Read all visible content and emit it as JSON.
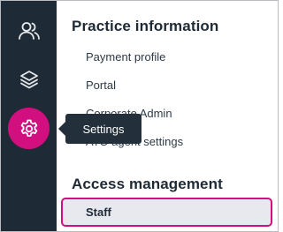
{
  "rail": {
    "items": [
      {
        "name": "people-icon",
        "active": false
      },
      {
        "name": "layers-icon",
        "active": false
      },
      {
        "name": "gear-icon",
        "active": true
      }
    ]
  },
  "tooltip": {
    "label": "Settings"
  },
  "sections": {
    "practice": {
      "title": "Practice information",
      "items": [
        "Payment profile",
        "Portal",
        "Corporate Admin",
        "ATO agent settings"
      ]
    },
    "access": {
      "title": "Access management",
      "items": [
        "Staff"
      ]
    }
  },
  "colors": {
    "rail_bg": "#1e2a35",
    "accent": "#d20f7f",
    "tooltip_bg": "#23303b",
    "active_item_bg": "#e8e9ee"
  }
}
